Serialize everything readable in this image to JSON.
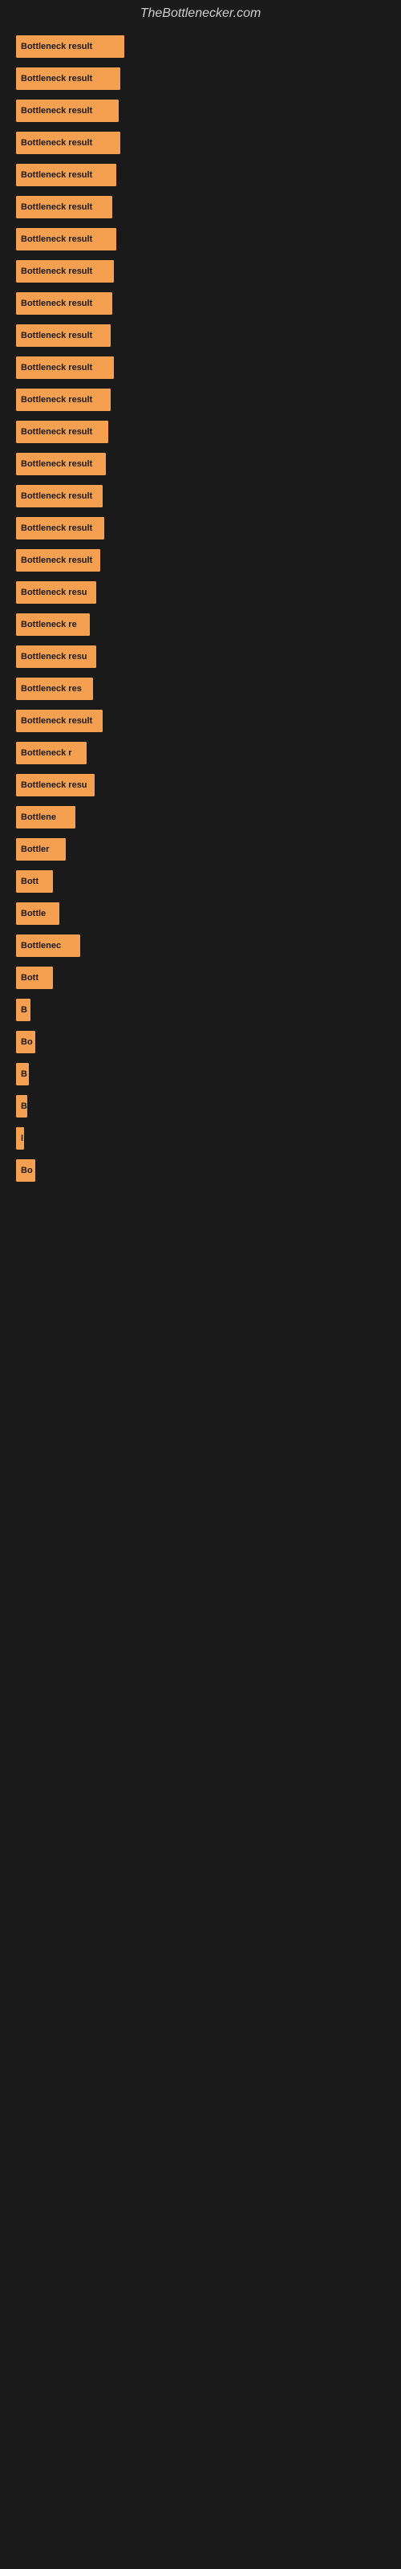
{
  "site": {
    "title": "TheBottlenecker.com"
  },
  "bars": [
    {
      "label": "Bottleneck result",
      "width": 135
    },
    {
      "label": "Bottleneck result",
      "width": 130
    },
    {
      "label": "Bottleneck result",
      "width": 128
    },
    {
      "label": "Bottleneck result",
      "width": 130
    },
    {
      "label": "Bottleneck result",
      "width": 125
    },
    {
      "label": "Bottleneck result",
      "width": 120
    },
    {
      "label": "Bottleneck result",
      "width": 125
    },
    {
      "label": "Bottleneck result",
      "width": 122
    },
    {
      "label": "Bottleneck result",
      "width": 120
    },
    {
      "label": "Bottleneck result",
      "width": 118
    },
    {
      "label": "Bottleneck result",
      "width": 122
    },
    {
      "label": "Bottleneck result",
      "width": 118
    },
    {
      "label": "Bottleneck result",
      "width": 115
    },
    {
      "label": "Bottleneck result",
      "width": 112
    },
    {
      "label": "Bottleneck result",
      "width": 108
    },
    {
      "label": "Bottleneck result",
      "width": 110
    },
    {
      "label": "Bottleneck result",
      "width": 105
    },
    {
      "label": "Bottleneck resu",
      "width": 100
    },
    {
      "label": "Bottleneck re",
      "width": 92
    },
    {
      "label": "Bottleneck resu",
      "width": 100
    },
    {
      "label": "Bottleneck res",
      "width": 96
    },
    {
      "label": "Bottleneck result",
      "width": 108
    },
    {
      "label": "Bottleneck r",
      "width": 88
    },
    {
      "label": "Bottleneck resu",
      "width": 98
    },
    {
      "label": "Bottlene",
      "width": 74
    },
    {
      "label": "Bottler",
      "width": 62
    },
    {
      "label": "Bott",
      "width": 46
    },
    {
      "label": "Bottle",
      "width": 54
    },
    {
      "label": "Bottlenec",
      "width": 80
    },
    {
      "label": "Bott",
      "width": 46
    },
    {
      "label": "B",
      "width": 18
    },
    {
      "label": "Bo",
      "width": 24
    },
    {
      "label": "B",
      "width": 16
    },
    {
      "label": "B",
      "width": 14
    },
    {
      "label": "I",
      "width": 10
    },
    {
      "label": "Bo",
      "width": 24
    }
  ]
}
